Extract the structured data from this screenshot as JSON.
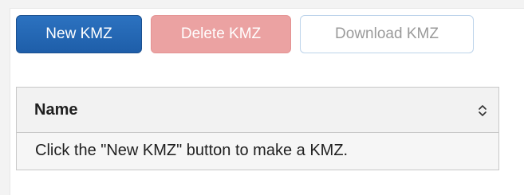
{
  "toolbar": {
    "new_label": "New KMZ",
    "delete_label": "Delete KMZ",
    "download_label": "Download KMZ"
  },
  "table": {
    "columns": [
      "Name"
    ],
    "sort_icon": "sort-up-down-icon",
    "empty_message": "Click the \"New KMZ\" button to make a KMZ."
  },
  "colors": {
    "primary": "#1e5ea9",
    "danger_disabled": "#eba2a2",
    "outline_disabled": "#bcd3ea"
  }
}
